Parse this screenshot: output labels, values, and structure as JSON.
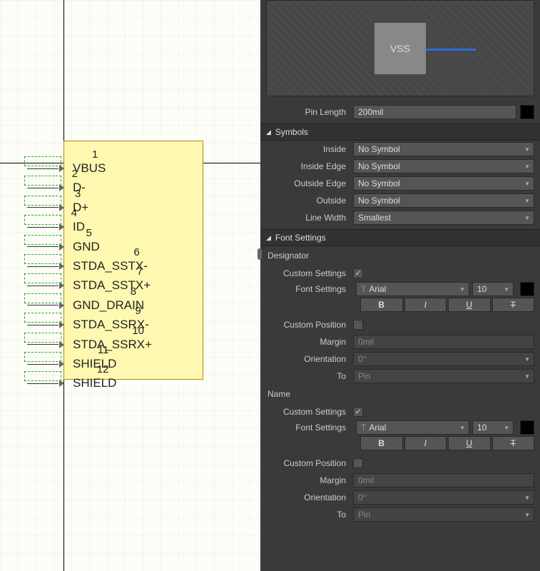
{
  "canvas": {
    "pins": [
      {
        "num": "1",
        "label": "VBUS"
      },
      {
        "num": "2",
        "label": "D-"
      },
      {
        "num": "3",
        "label": "D+"
      },
      {
        "num": "4",
        "label": "ID"
      },
      {
        "num": "5",
        "label": "GND"
      },
      {
        "num": "6",
        "label": "STDA_SSTX-"
      },
      {
        "num": "7",
        "label": "STDA_SSTX+"
      },
      {
        "num": "8",
        "label": "GND_DRAIN"
      },
      {
        "num": "9",
        "label": "STDA_SSRX-"
      },
      {
        "num": "10",
        "label": "STDA_SSRX+"
      },
      {
        "num": "11",
        "label": "SHIELD"
      },
      {
        "num": "12",
        "label": "SHIELD"
      }
    ]
  },
  "preview": {
    "chip_label": "VSS"
  },
  "fields": {
    "pin_length_label": "Pin Length",
    "pin_length": "200mil"
  },
  "sections": {
    "symbols": "Symbols",
    "font": "Font Settings"
  },
  "symbols": {
    "inside_label": "Inside",
    "inside": "No Symbol",
    "inside_edge_label": "Inside Edge",
    "inside_edge": "No Symbol",
    "outside_edge_label": "Outside Edge",
    "outside_edge": "No Symbol",
    "outside_label": "Outside",
    "outside": "No Symbol",
    "line_width_label": "Line Width",
    "line_width": "Smallest"
  },
  "font": {
    "designator_label": "Designator",
    "name_label": "Name",
    "custom_settings_label": "Custom Settings",
    "font_settings_label": "Font Settings",
    "custom_position_label": "Custom Position",
    "margin_label": "Margin",
    "margin": "0mil",
    "orientation_label": "Orientation",
    "orientation": "0°",
    "to_label": "To",
    "to": "Pin",
    "font_name": "Arial",
    "font_size": "10",
    "bold": "B",
    "italic": "I",
    "underline": "U",
    "strike": "T",
    "check": "✓"
  }
}
